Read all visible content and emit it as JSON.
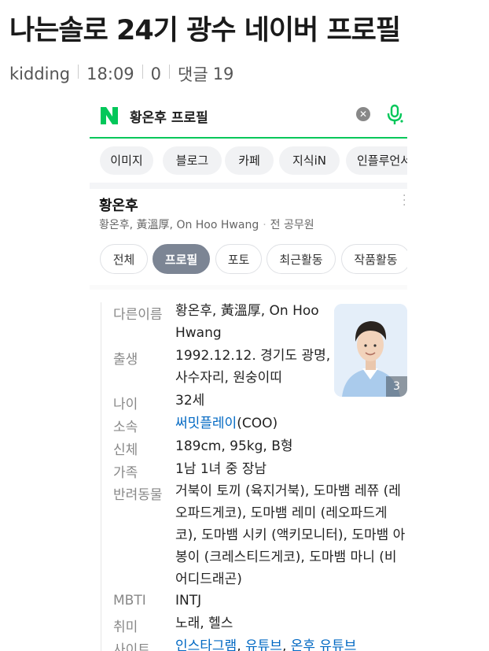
{
  "post": {
    "title": "나는솔로 24기 광수 네이버 프로필",
    "author": "kidding",
    "time": "18:09",
    "views": "0",
    "comments_label": "댓글",
    "comments_count": "19"
  },
  "search": {
    "query": "황온후 프로필",
    "chips": [
      "이미지",
      "블로그",
      "카페",
      "지식iN",
      "인플루언서"
    ]
  },
  "entity": {
    "name": "황온후",
    "aliases": "황온후, 黃溫厚, On Hoo Hwang",
    "role": "전 공무원",
    "tabs": [
      "전체",
      "프로필",
      "포토",
      "최근활동",
      "작품활동"
    ],
    "photo_count": "3"
  },
  "profile": {
    "other_names_label": "다른이름",
    "other_names_line1": "황온후, 黃溫厚, On Hoo",
    "other_names_line2": "Hwang",
    "birth_label": "출생",
    "birth_line1": "1992.12.12. 경기도 광명,",
    "birth_line2": "사수자리, 원숭이띠",
    "age_label": "나이",
    "age": "32세",
    "affiliation_label": "소속",
    "affiliation_link": "써밋플레이",
    "affiliation_suffix": "(COO)",
    "body_label": "신체",
    "body": "189cm, 95kg, B형",
    "family_label": "가족",
    "family": "1남 1녀 중 장남",
    "pets_label": "반려동물",
    "pets_line1": "거북이 토끼 (육지거북), 도마뱀 레쮸 (레",
    "pets_line2": "오파드게코), 도마뱀 레미 (레오파드게",
    "pets_line3": "코), 도마뱀 시키 (액키모니터), 도마뱀 아",
    "pets_line4": "봉이 (크레스티드게코), 도마뱀 마니 (비",
    "pets_line5": "어디드래곤)",
    "mbti_label": "MBTI",
    "mbti": "INTJ",
    "hobby_label": "취미",
    "hobby": "노래, 헬스",
    "site_label": "사이트",
    "site_links": [
      "인스타그램",
      "유튜브",
      "온후 유튜브"
    ]
  },
  "colors": {
    "naver_green": "#03c75a",
    "link_blue": "#0068c3",
    "active_tab": "#7c8594"
  }
}
